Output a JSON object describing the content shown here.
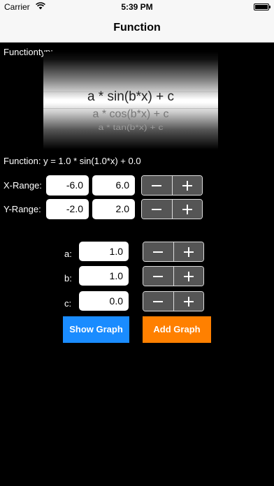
{
  "status": {
    "carrier": "Carrier",
    "time": "5:39 PM"
  },
  "nav": {
    "title": "Function"
  },
  "function_type_label": "Functiontyp:",
  "picker": {
    "selected": "a * sin(b*x) + c",
    "options_below": [
      "a * cos(b*x) + c",
      "a * tan(b*x) + c"
    ]
  },
  "function_label": "Function:",
  "function_value": "y = 1.0 * sin(1.0*x) + 0.0",
  "x_range": {
    "label": "X-Range:",
    "min": "-6.0",
    "max": "6.0"
  },
  "y_range": {
    "label": "Y-Range:",
    "min": "-2.0",
    "max": "2.0"
  },
  "params": [
    {
      "label": "a:",
      "value": "1.0"
    },
    {
      "label": "b:",
      "value": "1.0"
    },
    {
      "label": "c:",
      "value": "0.0"
    }
  ],
  "buttons": {
    "show_graph": "Show Graph",
    "add_graph": "Add Graph"
  },
  "colors": {
    "show_graph_bg": "#1a8cff",
    "add_graph_bg": "#ff8000",
    "stepper_bg": "#555555"
  }
}
